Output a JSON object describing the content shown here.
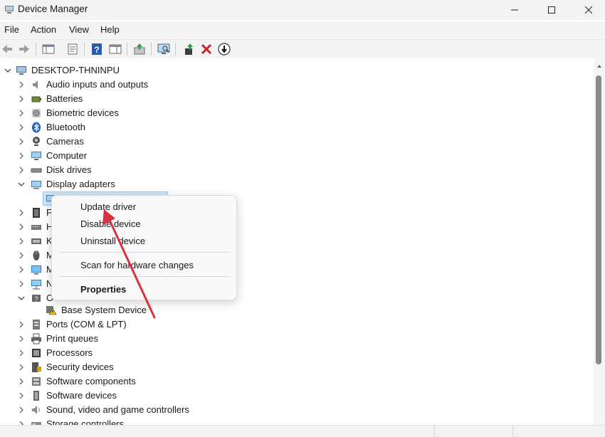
{
  "window": {
    "title": "Device Manager",
    "accent_arrow_color": "#d8323c"
  },
  "menu": [
    "File",
    "Action",
    "View",
    "Help"
  ],
  "toolbar": {
    "buttons": [
      "back-icon",
      "forward-icon",
      "show-hide-console-tree-icon",
      "properties-icon",
      "help-icon",
      "action-pane-icon",
      "update-driver-icon",
      "scan-hardware-icon",
      "enable-device-icon",
      "uninstall-icon",
      "disable-device-icon"
    ]
  },
  "tree": {
    "root": "DESKTOP-THNINPU",
    "categories": [
      {
        "label": "Audio inputs and outputs",
        "icon": "speaker-icon"
      },
      {
        "label": "Batteries",
        "icon": "battery-icon"
      },
      {
        "label": "Biometric devices",
        "icon": "fingerprint-icon"
      },
      {
        "label": "Bluetooth",
        "icon": "bluetooth-icon"
      },
      {
        "label": "Cameras",
        "icon": "camera-icon"
      },
      {
        "label": "Computer",
        "icon": "computer-icon"
      },
      {
        "label": "Disk drives",
        "icon": "disk-drive-icon"
      },
      {
        "label": "Display adapters",
        "icon": "display-adapter-icon"
      },
      {
        "label": "F",
        "icon": "firmware-icon"
      },
      {
        "label": "H",
        "icon": "hid-icon"
      },
      {
        "label": "K",
        "icon": "keyboard-icon"
      },
      {
        "label": "M",
        "icon": "mouse-icon"
      },
      {
        "label": "M",
        "icon": "monitor-icon"
      },
      {
        "label": "N",
        "icon": "network-adapter-icon"
      },
      {
        "label": "O",
        "icon": "other-devices-icon"
      },
      {
        "label": "Base System Device",
        "icon": "warning-device-icon"
      },
      {
        "label": "Ports (COM & LPT)",
        "icon": "port-icon"
      },
      {
        "label": "Print queues",
        "icon": "printer-icon"
      },
      {
        "label": "Processors",
        "icon": "processor-icon"
      },
      {
        "label": "Security devices",
        "icon": "security-icon"
      },
      {
        "label": "Software components",
        "icon": "software-component-icon"
      },
      {
        "label": "Software devices",
        "icon": "software-device-icon"
      },
      {
        "label": "Sound, video and game controllers",
        "icon": "sound-icon"
      },
      {
        "label": "Storage controllers",
        "icon": "storage-icon"
      }
    ]
  },
  "context_menu": {
    "items": [
      "Update driver",
      "Disable device",
      "Uninstall device",
      "Scan for hardware changes",
      "Properties"
    ]
  }
}
